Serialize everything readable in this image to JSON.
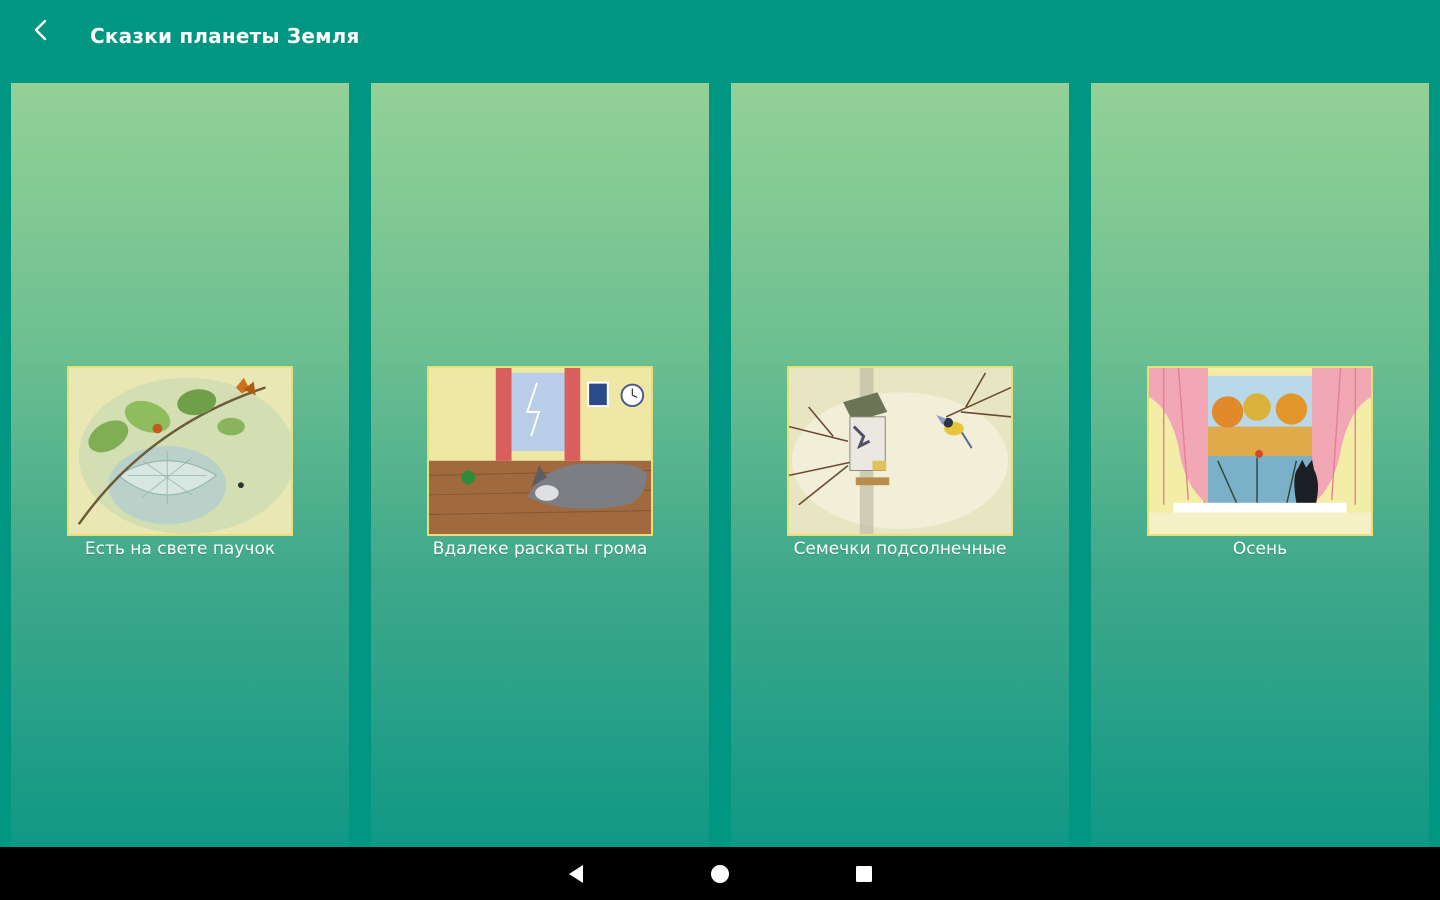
{
  "app_bar": {
    "title": "Сказки планеты Земля",
    "back_icon": "chevron-left-icon"
  },
  "stories": [
    {
      "label": "Есть на свете паучок",
      "image": "spider-web-painting"
    },
    {
      "label": "Вдалеке раскаты грома",
      "image": "dog-by-window-painting"
    },
    {
      "label": "Семечки подсолнечные",
      "image": "bird-feeder-painting"
    },
    {
      "label": "Осень",
      "image": "autumn-window-painting"
    }
  ],
  "nav_bar": {
    "back_icon": "triangle-back-icon",
    "home_icon": "circle-home-icon",
    "recents_icon": "square-recents-icon"
  },
  "colors": {
    "primary": "#009682",
    "card_top": "#93d196",
    "card_bottom": "#109886",
    "nav_bar": "#000000"
  }
}
